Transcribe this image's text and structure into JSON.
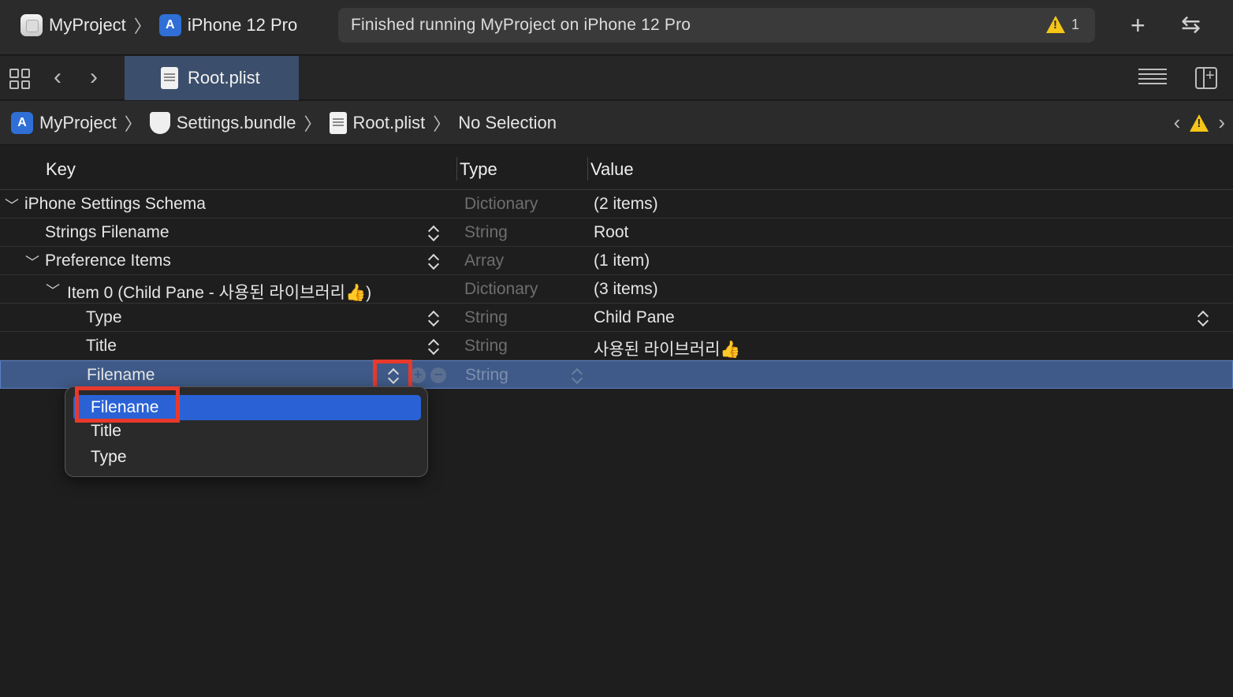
{
  "toolbar": {
    "scheme_app": "MyProject",
    "scheme_device": "iPhone 12 Pro",
    "status_text": "Finished running MyProject on iPhone 12 Pro",
    "warning_count": "1",
    "add_symbol": "+",
    "swap_symbol": "⇆"
  },
  "tabbar": {
    "back_symbol": "‹",
    "forward_symbol": "›",
    "active_tab": "Root.plist"
  },
  "jumpbar": {
    "crumbs": [
      "MyProject",
      "Settings.bundle",
      "Root.plist",
      "No Selection"
    ],
    "prev_symbol": "‹",
    "next_symbol": "›"
  },
  "table": {
    "headers": {
      "key": "Key",
      "type": "Type",
      "value": "Value"
    },
    "rows": [
      {
        "key": "iPhone Settings Schema",
        "type": "Dictionary",
        "value": "(2 items)"
      },
      {
        "key": "Strings Filename",
        "type": "String",
        "value": "Root"
      },
      {
        "key": "Preference Items",
        "type": "Array",
        "value": "(1 item)"
      },
      {
        "key": "Item 0 (Child Pane - 사용된 라이브러리👍)",
        "type": "Dictionary",
        "value": "(3 items)"
      },
      {
        "key": "Type",
        "type": "String",
        "value": "Child Pane"
      },
      {
        "key": "Title",
        "type": "String",
        "value": "사용된 라이브러리👍"
      },
      {
        "key": "Filename",
        "type": "String",
        "value": ""
      }
    ]
  },
  "dropdown": {
    "options": [
      "Filename",
      "Title",
      "Type"
    ],
    "selected": "Filename"
  },
  "colors": {
    "selection": "#3f5a88",
    "menu_highlight": "#2a62d6",
    "annotation": "#e8392b",
    "warning": "#f5c518"
  }
}
